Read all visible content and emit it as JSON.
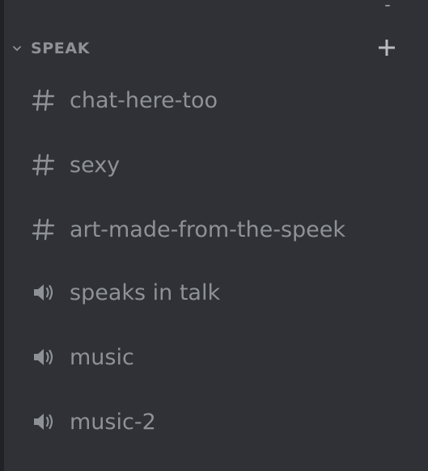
{
  "category": {
    "label": "SPEAK",
    "collapse_icon": "chevron-down-icon",
    "add_icon": "plus-icon"
  },
  "channels": [
    {
      "name": "chat-here-too",
      "type": "text",
      "icon": "hash-icon"
    },
    {
      "name": "sexy",
      "type": "text",
      "icon": "hash-icon"
    },
    {
      "name": "art-made-from-the-speek",
      "type": "text",
      "icon": "hash-icon"
    },
    {
      "name": "speaks in talk",
      "type": "voice",
      "icon": "speaker-icon"
    },
    {
      "name": "music",
      "type": "voice",
      "icon": "speaker-icon"
    },
    {
      "name": "music-2",
      "type": "voice",
      "icon": "speaker-icon"
    }
  ],
  "colors": {
    "background": "#2f3136",
    "muted_text": "#8e9297",
    "edge": "#202225"
  }
}
